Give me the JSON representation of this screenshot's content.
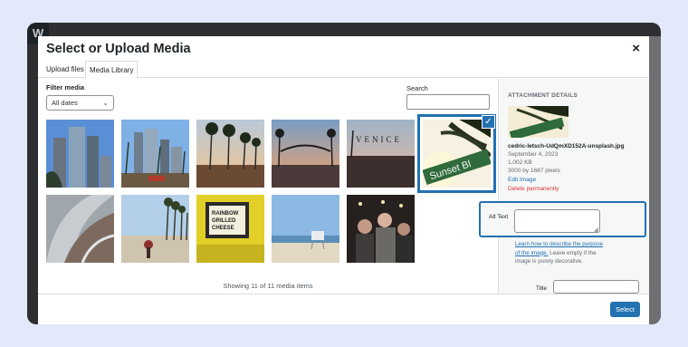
{
  "modal": {
    "title": "Select or Upload Media",
    "close_icon": "close-icon"
  },
  "tabs": [
    {
      "label": "Upload files",
      "active": false
    },
    {
      "label": "Media Library",
      "active": true
    }
  ],
  "filter": {
    "label": "Filter media",
    "selected": "All dates"
  },
  "search": {
    "label": "Search",
    "value": ""
  },
  "media_items": [
    {
      "description": "Glass skyscrapers against blue sky",
      "selected": false
    },
    {
      "description": "Downtown skyline with palm trees",
      "selected": false
    },
    {
      "description": "Palm trees at sunset street",
      "selected": false
    },
    {
      "description": "Venice sign at dusk",
      "selected": false
    },
    {
      "description": "Venice lettering over street",
      "selected": false
    },
    {
      "description": "Sunset Bl street sign",
      "selected": true
    },
    {
      "description": "Curved metal architecture",
      "selected": false
    },
    {
      "description": "Boardwalk with palm trees",
      "selected": false
    },
    {
      "description": "Yellow food stand sign",
      "selected": false
    },
    {
      "description": "Lifeguard tower on beach",
      "selected": false
    },
    {
      "description": "People at night event",
      "selected": false
    }
  ],
  "grid_status": "Showing 11 of 11 media items",
  "attachment": {
    "heading": "ATTACHMENT DETAILS",
    "filename": "cedric-letsch-UdQmXD152A-unsplash.jpg",
    "date": "September 4, 2023",
    "filesize": "1,002 KB",
    "dimensions": "3000 by 1687 pixels",
    "edit_label": "Edit Image",
    "delete_label": "Delete permanently",
    "alt_label": "Alt Text",
    "alt_value": "",
    "describe_link": "Learn how to describe the purpose of the image.",
    "describe_rest": "Leave empty if the image is purely decorative.",
    "title_label": "Title",
    "title_value": ""
  },
  "toolbar": {
    "select_label": "Select"
  },
  "colors": {
    "accent": "#2271b1",
    "delete": "#d63638",
    "background": "#e3e9fb"
  },
  "wp_logo": "W"
}
